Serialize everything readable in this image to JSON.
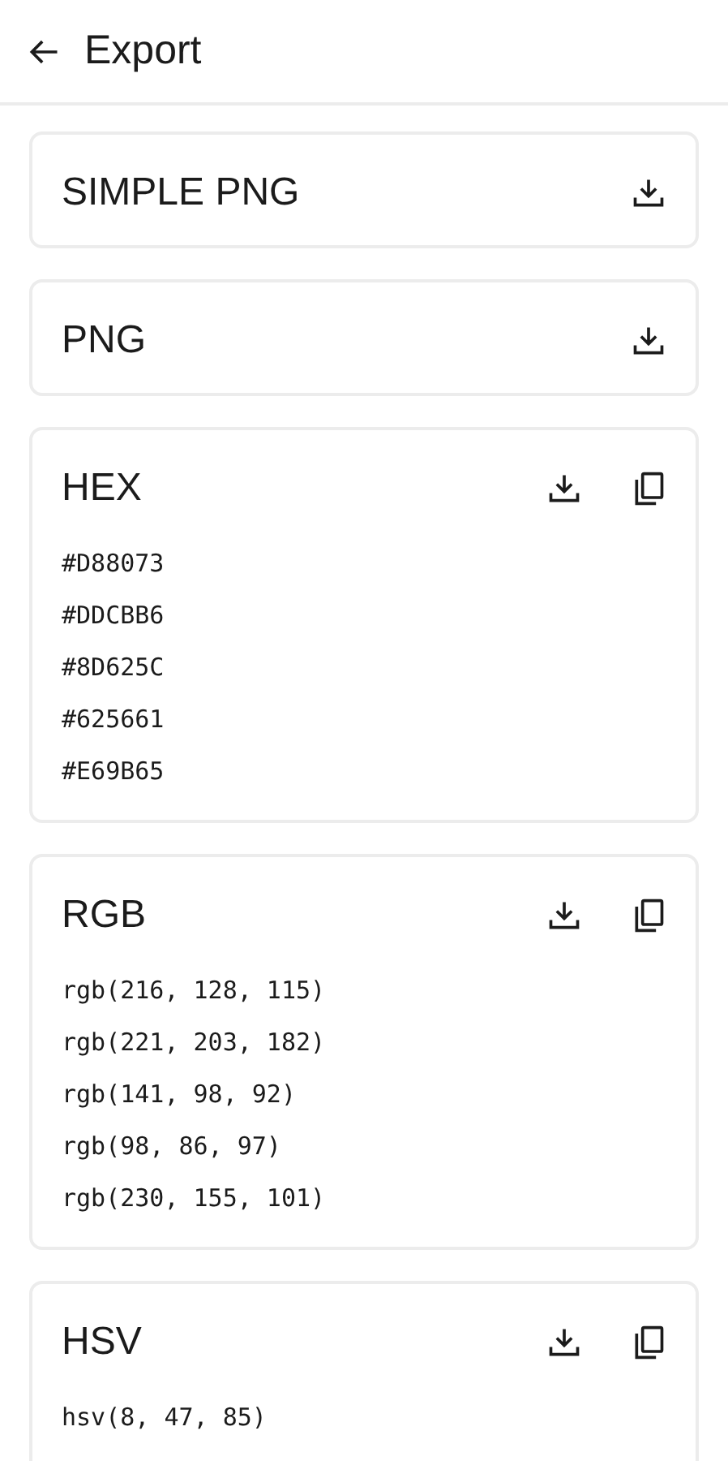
{
  "app_bar": {
    "title": "Export"
  },
  "sections": [
    {
      "title": "SIMPLE PNG",
      "actions": [
        {
          "kind": "download"
        }
      ]
    },
    {
      "title": "PNG",
      "actions": [
        {
          "kind": "download"
        }
      ]
    },
    {
      "title": "HEX",
      "actions": [
        {
          "kind": "download"
        },
        {
          "kind": "copy"
        }
      ],
      "lines": [
        "#D88073",
        "#DDCBB6",
        "#8D625C",
        "#625661",
        "#E69B65"
      ]
    },
    {
      "title": "RGB",
      "actions": [
        {
          "kind": "download"
        },
        {
          "kind": "copy"
        }
      ],
      "lines": [
        "rgb(216, 128, 115)",
        "rgb(221, 203, 182)",
        "rgb(141, 98, 92)",
        "rgb(98, 86, 97)",
        "rgb(230, 155, 101)"
      ]
    },
    {
      "title": "HSV",
      "actions": [
        {
          "kind": "download"
        },
        {
          "kind": "copy"
        }
      ],
      "lines": [
        "hsv(8, 47, 85)"
      ]
    }
  ]
}
